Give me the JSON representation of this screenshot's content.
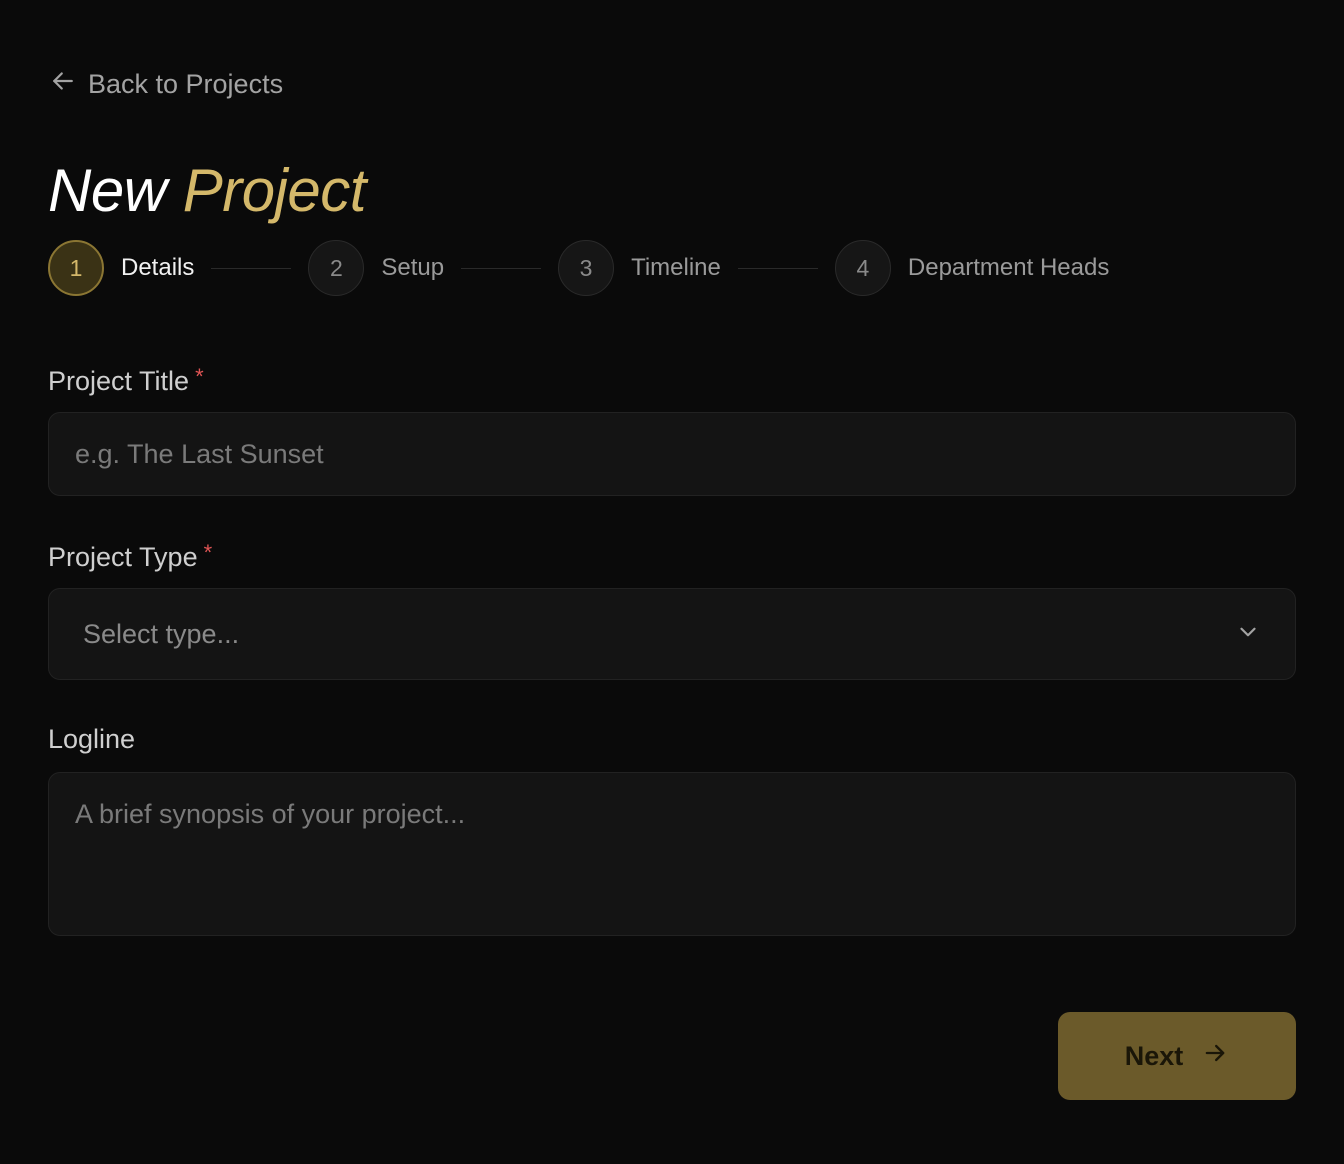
{
  "nav": {
    "back_label": "Back to Projects"
  },
  "header": {
    "title_part1": "New",
    "title_part2": "Project"
  },
  "stepper": {
    "steps": [
      {
        "number": "1",
        "label": "Details",
        "active": true
      },
      {
        "number": "2",
        "label": "Setup",
        "active": false
      },
      {
        "number": "3",
        "label": "Timeline",
        "active": false
      },
      {
        "number": "4",
        "label": "Department Heads",
        "active": false
      }
    ]
  },
  "form": {
    "title": {
      "label": "Project Title",
      "required_mark": "*",
      "value": "",
      "placeholder": "e.g. The Last Sunset"
    },
    "type": {
      "label": "Project Type",
      "required_mark": "*",
      "selected": "Select type..."
    },
    "logline": {
      "label": "Logline",
      "value": "",
      "placeholder": "A brief synopsis of your project..."
    }
  },
  "actions": {
    "next_label": "Next"
  },
  "colors": {
    "background": "#0a0a0a",
    "accent_gold": "#d4b86a",
    "button_gold": "#6b5a2a",
    "required_red": "#e05555"
  },
  "icons": {
    "back": "arrow-left-icon",
    "select": "chevron-down-icon",
    "next": "arrow-right-icon"
  }
}
